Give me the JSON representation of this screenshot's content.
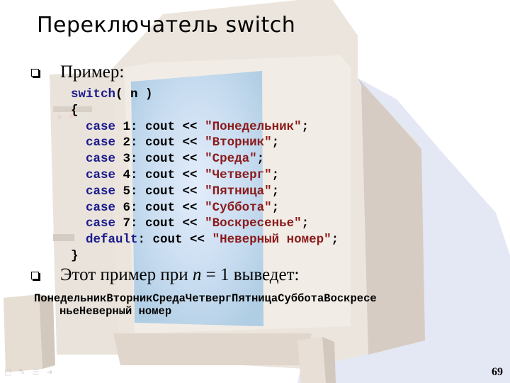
{
  "slide": {
    "title": "Переключатель switch",
    "bullets": [
      {
        "text": "Пример:"
      },
      {
        "text_before": "Этот пример при ",
        "variable": "n",
        "text_after": " = 1 выведет:"
      }
    ],
    "code": {
      "header": {
        "keyword": "switch",
        "rest": "( n )"
      },
      "open_brace": "{",
      "cases": [
        {
          "keyword": "case",
          "label": " 1: cout << ",
          "string": "\"Понедельник\"",
          "end": ";"
        },
        {
          "keyword": "case",
          "label": " 2: cout << ",
          "string": "\"Вторник\"",
          "end": ";"
        },
        {
          "keyword": "case",
          "label": " 3: cout << ",
          "string": "\"Среда\"",
          "end": ";"
        },
        {
          "keyword": "case",
          "label": " 4: cout << ",
          "string": "\"Четверг\"",
          "end": ";"
        },
        {
          "keyword": "case",
          "label": " 5: cout << ",
          "string": "\"Пятница\"",
          "end": ";"
        },
        {
          "keyword": "case",
          "label": " 6: cout << ",
          "string": "\"Суббота\"",
          "end": ";"
        },
        {
          "keyword": "case",
          "label": " 7: cout << ",
          "string": "\"Воскресенье\"",
          "end": ";"
        },
        {
          "keyword": "default",
          "label": ": cout << ",
          "string": "\"Неверный номер\"",
          "end": ";"
        }
      ],
      "close_brace": "}"
    },
    "output": {
      "line1": "ПонедельникВторникСредаЧетвергПятницаСубботаВоскресе",
      "line2": "ньеНеверный номер"
    },
    "page_number": "69",
    "nav_icons": [
      "comment-icon",
      "pen-icon",
      "menu-icon",
      "next-slide-icon"
    ]
  }
}
